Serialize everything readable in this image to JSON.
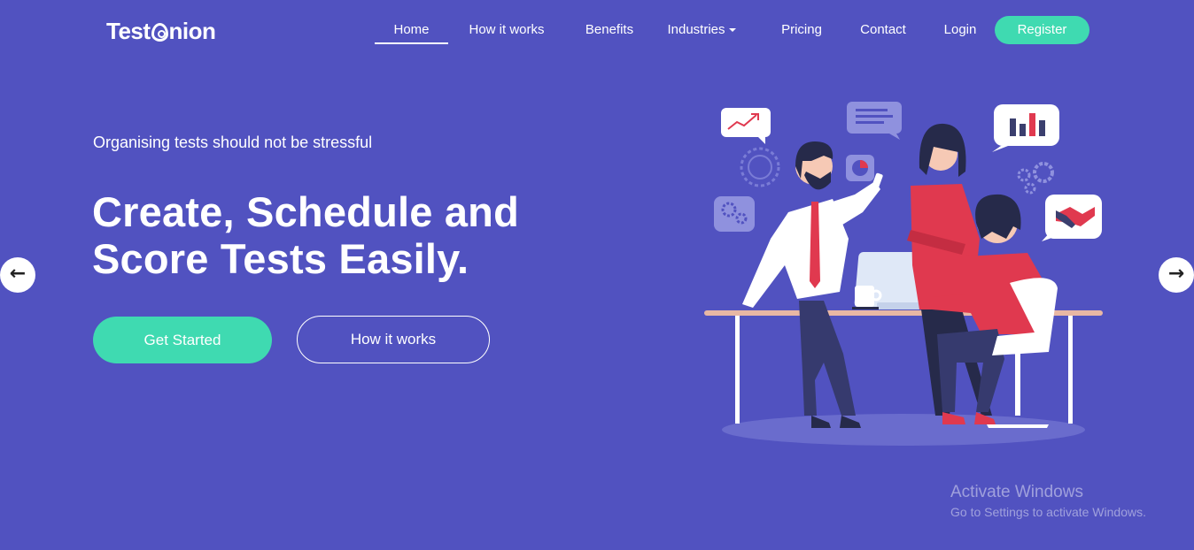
{
  "brand": {
    "name_part1": "Test",
    "name_part2": "nion"
  },
  "nav": {
    "items": [
      {
        "label": "Home",
        "active": true
      },
      {
        "label": "How it works"
      },
      {
        "label": "Benefits"
      },
      {
        "label": "Industries",
        "has_dropdown": true
      },
      {
        "label": "Pricing"
      },
      {
        "label": "Contact"
      },
      {
        "label": "Login"
      }
    ],
    "register_label": "Register"
  },
  "hero": {
    "tagline": "Organising tests should not be stressful",
    "headline_line1": "Create, Schedule and",
    "headline_line2": "Score Tests Easily.",
    "primary_button": "Get Started",
    "secondary_button": "How it works"
  },
  "carousel": {
    "prev_icon": "arrow-left-icon",
    "next_icon": "arrow-right-icon"
  },
  "watermark": {
    "title": "Activate Windows",
    "subtitle": "Go to Settings to activate Windows."
  },
  "colors": {
    "background": "#5152c0",
    "accent": "#3fdab1",
    "illustration_red": "#e0394f",
    "illustration_navy": "#262a4a"
  }
}
